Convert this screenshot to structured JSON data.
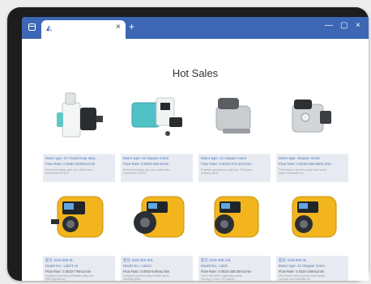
{
  "browser": {
    "tab_close": "×",
    "new_tab": "+",
    "minimize": "—",
    "maximize": "▢",
    "close": "×"
  },
  "page": {
    "title": "Hot Sales",
    "products": [
      {
        "motor_type": "Motor type:  57 closed loop step...",
        "flow_rate": "Flow Rate:  0.0053-3100mL/min",
        "desc1": "Brand new design, give you a brand new",
        "desc2": "experience! 6.6 inch"
      },
      {
        "motor_type": "Motor type:  42 stepper motor",
        "flow_rate": "Flow Rate:  0.0002-65mL/min",
        "desc1": "Brand new design, give you a brand new",
        "desc2": "experience! 4.3 inch"
      },
      {
        "motor_type": "Motor type:  42 stepper motor",
        "flow_rate": "Flow Rate:  0.0033-373.2mL/min",
        "desc1": "Exquisite appearance, small size. The space",
        "desc2": "pressing block !"
      },
      {
        "motor_type": "Motor type:  Stepper motor",
        "flow_rate": "Flow Rate:  0.0033-360.89mL/min",
        "desc1": "From brass to open the pump head saves",
        "desc2": "space. Automatic tool"
      },
      {
        "model_kr": "型号:  ExD-600-3L",
        "model": "Model No.:  LabF1-III",
        "flow_rate": "Flow Rate:  0.0033-775mL/min",
        "desc1": "Intelligent dispensing peristaltic pump with",
        "desc2": "MBS engineering"
      },
      {
        "model_kr": "型号:  ExD-300-30L",
        "model": "Model No.:  LabV1",
        "flow_rate": "Flow Rate:  0.0002-9.65mL/min",
        "desc1": "Intelligent type flow rate peristaltic pump.",
        "desc2": "Industrial grade"
      },
      {
        "model_kr": "型号:  ExD-300-13L",
        "model": "Model No.:  LabG",
        "flow_rate": "Flow Rate:  0.0033-326.55mL/min",
        "desc1": "LabV1 with MBS engineering plastic",
        "desc2": "housing,4.3 inch LCD display"
      },
      {
        "model_kr": "型号:  ExD-600-3L",
        "model": "Motor type:  42 Stepper motor",
        "flow_rate": "Flow Rate:  0.0024-160mL/min",
        "desc1": "Mini-Printer series products which adopt",
        "desc2": "compact and embedded de"
      }
    ]
  }
}
